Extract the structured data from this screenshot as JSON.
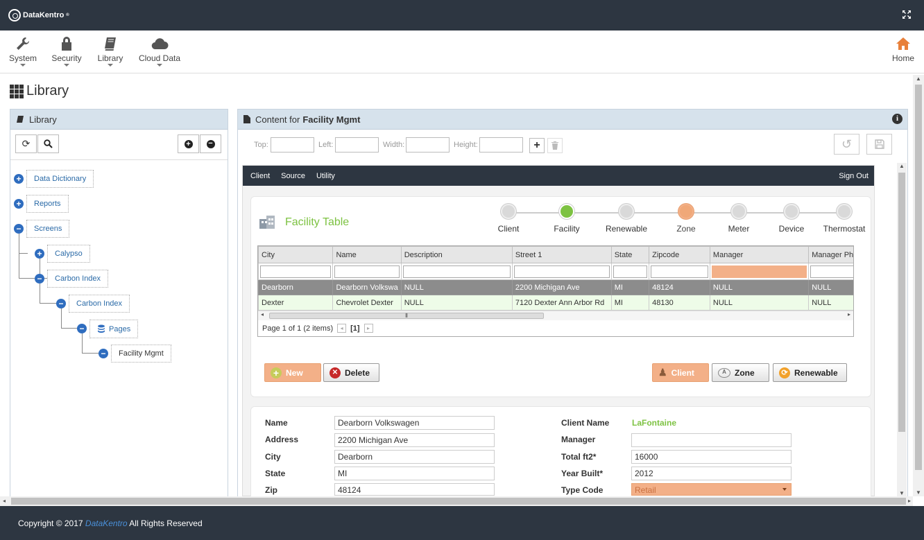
{
  "brand": {
    "name": "DataKentro",
    "trademark": "®"
  },
  "menu": [
    {
      "label": "System",
      "icon": "wrench-icon"
    },
    {
      "label": "Security",
      "icon": "lock-icon"
    },
    {
      "label": "Library",
      "icon": "book-icon"
    },
    {
      "label": "Cloud Data",
      "icon": "cloud-icon"
    }
  ],
  "home": {
    "label": "Home",
    "color": "#e8803a"
  },
  "page_title": "Library",
  "library_panel": {
    "title": "Library"
  },
  "tree": [
    {
      "label": "Data Dictionary"
    },
    {
      "label": "Reports"
    },
    {
      "label": "Screens"
    },
    {
      "label": "Calypso"
    },
    {
      "label": "Carbon Index"
    },
    {
      "label": "Carbon Index"
    },
    {
      "label": "Pages"
    },
    {
      "label": "Facility Mgmt"
    }
  ],
  "content_panel": {
    "prefix": "Content for",
    "name": "Facility Mgmt"
  },
  "pos": {
    "top_label": "Top:",
    "left_label": "Left:",
    "width_label": "Width:",
    "height_label": "Height:",
    "top": "",
    "left": "",
    "width": "",
    "height": ""
  },
  "app": {
    "nav": [
      "Client",
      "Source",
      "Utility"
    ],
    "signout": "Sign Out",
    "table_title": "Facility Table",
    "steps": [
      "Client",
      "Facility",
      "Renewable",
      "Zone",
      "Meter",
      "Device",
      "Thermostat"
    ],
    "active_step": "Facility",
    "highlight_step": "Zone",
    "columns": [
      "City",
      "Name",
      "Description",
      "Street 1",
      "State",
      "Zipcode",
      "Manager",
      "Manager Pho"
    ],
    "rows": [
      [
        "Dearborn",
        "Dearborn Volkswa",
        "NULL",
        "2200 Michigan Ave",
        "MI",
        "48124",
        "NULL",
        "NULL"
      ],
      [
        "Dexter",
        "Chevrolet Dexter",
        "NULL",
        "7120 Dexter Ann Arbor Rd",
        "MI",
        "48130",
        "NULL",
        "NULL"
      ]
    ],
    "pager": {
      "text": "Page 1 of 1 (2 items)",
      "current": "[1]"
    },
    "buttons": {
      "new": "New",
      "delete": "Delete",
      "client": "Client",
      "zone": "Zone",
      "renewable": "Renewable"
    },
    "form": {
      "name_label": "Name",
      "name": "Dearborn Volkswagen",
      "address_label": "Address",
      "address": "2200 Michigan Ave",
      "city_label": "City",
      "city": "Dearborn",
      "state_label": "State",
      "state": "MI",
      "zip_label": "Zip",
      "zip": "48124",
      "client_name_label": "Client Name",
      "client_name": "LaFontaine",
      "manager_label": "Manager",
      "manager": "",
      "total_label": "Total ft2*",
      "total": "16000",
      "year_label": "Year Built*",
      "year": "2012",
      "type_label": "Type Code",
      "type": "Retail"
    }
  },
  "footer": {
    "copyright": "Copyright © 2017",
    "brand": "DataKentro",
    "rights": "All Rights Reserved"
  },
  "colors": {
    "accent": "#e8803a",
    "green": "#7dc242",
    "nav": "#2d3641",
    "link": "#2a6aa7"
  }
}
